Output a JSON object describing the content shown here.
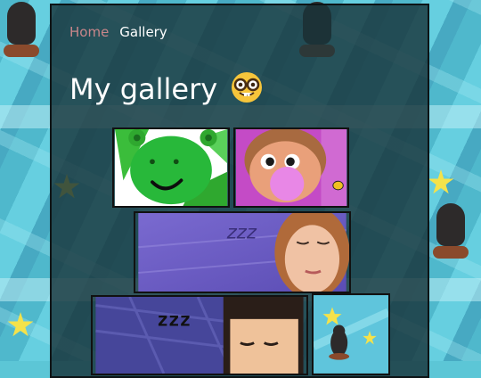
{
  "breadcrumb": {
    "home": "Home",
    "current": "Gallery"
  },
  "page": {
    "title": "My gallery",
    "title_emoji": "nerd-face-emoji"
  },
  "gallery": [
    {
      "name": "green-alien-drawing"
    },
    {
      "name": "bubblegum-boy-drawing"
    },
    {
      "name": "sleeping-woman-drawing",
      "caption": "zzz"
    },
    {
      "name": "sleeping-boy-pixel-drawing",
      "caption": "zzz"
    },
    {
      "name": "mole-with-stars-drawing"
    }
  ],
  "colors": {
    "panel": "#18343a",
    "link": "#c9868a",
    "text": "#ffffff",
    "background": "#5cc6d6"
  }
}
